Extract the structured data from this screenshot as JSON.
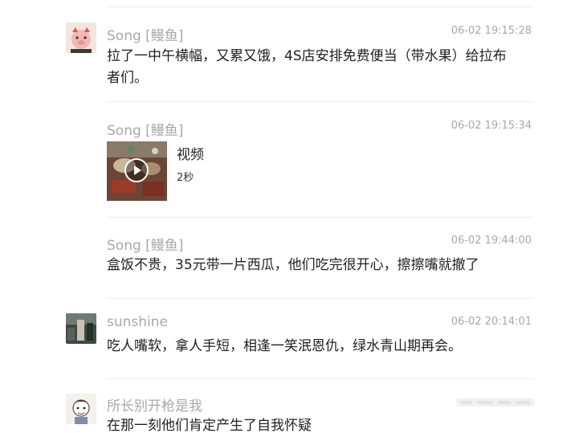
{
  "messages": [
    {
      "sender": "Song [鳗鱼]",
      "time": "06-02 19:15:28",
      "text": "拉了一中午横幅，又累又饿，4S店安排免费便当（带水果）给拉布者们。",
      "avatar": "cartoon-pig-avatar"
    },
    {
      "sender": "Song [鳗鱼]",
      "time": "06-02 19:15:34",
      "video": {
        "title": "视频",
        "duration": "2秒",
        "icon": "play-icon"
      }
    },
    {
      "sender": "Song [鳗鱼]",
      "time": "06-02 19:44:00",
      "text": "盒饭不贵，35元带一片西瓜，他们吃完很开心，擦擦嘴就撤了"
    },
    {
      "sender": "sunshine",
      "time": "06-02 20:14:01",
      "text": "吃人嘴软，拿人手短，相逢一笑泯恩仇，绿水青山期再会。",
      "avatar": "photo-avatar"
    },
    {
      "sender": "所长别开枪是我",
      "text": "在那一刻他们肯定产生了自我怀疑",
      "avatar": "cartoon-avatar"
    }
  ],
  "colors": {
    "sender": "#a8a8a8",
    "body_text": "#1f1f1f",
    "divider": "#ececec",
    "background": "#ffffff"
  }
}
